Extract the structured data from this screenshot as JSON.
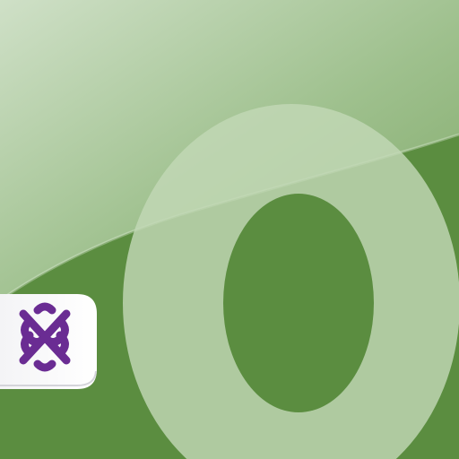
{
  "icon": {
    "name": "app-icon",
    "letter_glyph": "o",
    "badge_icon": "interlaced-ribbon-logo-icon"
  },
  "colors": {
    "background_dark": "#5a8c3f",
    "background_light": "#c9dcc0",
    "glyph_fill": "#c2d8b6",
    "badge_purple": "#6a2c93",
    "badge_white": "#ffffff"
  }
}
